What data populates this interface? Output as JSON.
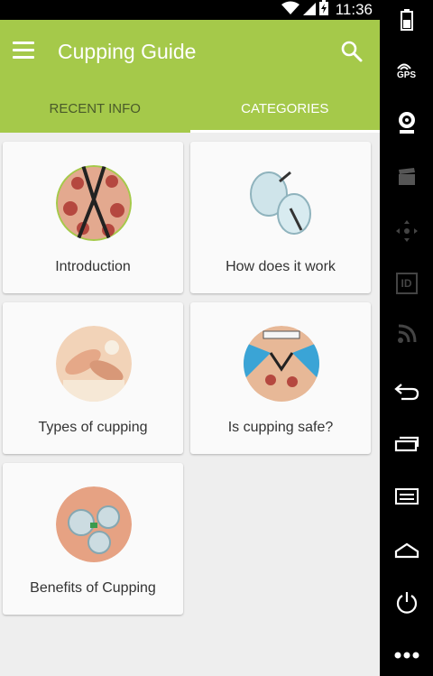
{
  "status_bar": {
    "time": "11:36",
    "icons": [
      "wifi-icon",
      "signal-icon",
      "battery-charging-icon"
    ]
  },
  "app_bar": {
    "title": "Cupping Guide",
    "menu_icon": "hamburger-menu-icon",
    "search_icon": "search-icon",
    "background_color": "#a5c94a"
  },
  "tabs": [
    {
      "label": "RECENT INFO",
      "active": false
    },
    {
      "label": "CATEGORIES",
      "active": true
    }
  ],
  "categories": [
    {
      "label": "Introduction",
      "image": "back-with-cups-image"
    },
    {
      "label": "How does it work",
      "image": "glass-cups-image"
    },
    {
      "label": "Types of cupping",
      "image": "hands-massage-image"
    },
    {
      "label": "Is cupping safe?",
      "image": "cupping-session-image"
    },
    {
      "label": "Benefits of Cupping",
      "image": "cups-on-skin-image"
    }
  ],
  "navigation_bar": {
    "items": [
      "battery-icon",
      "gps-icon",
      "camera-icon",
      "clapper-icon",
      "dpad-icon",
      "id-icon",
      "rss-icon",
      "back-icon",
      "recent-apps-icon",
      "menu-icon",
      "home-icon",
      "power-icon",
      "more-icon"
    ],
    "gps_label": "GPS",
    "id_label": "ID"
  }
}
